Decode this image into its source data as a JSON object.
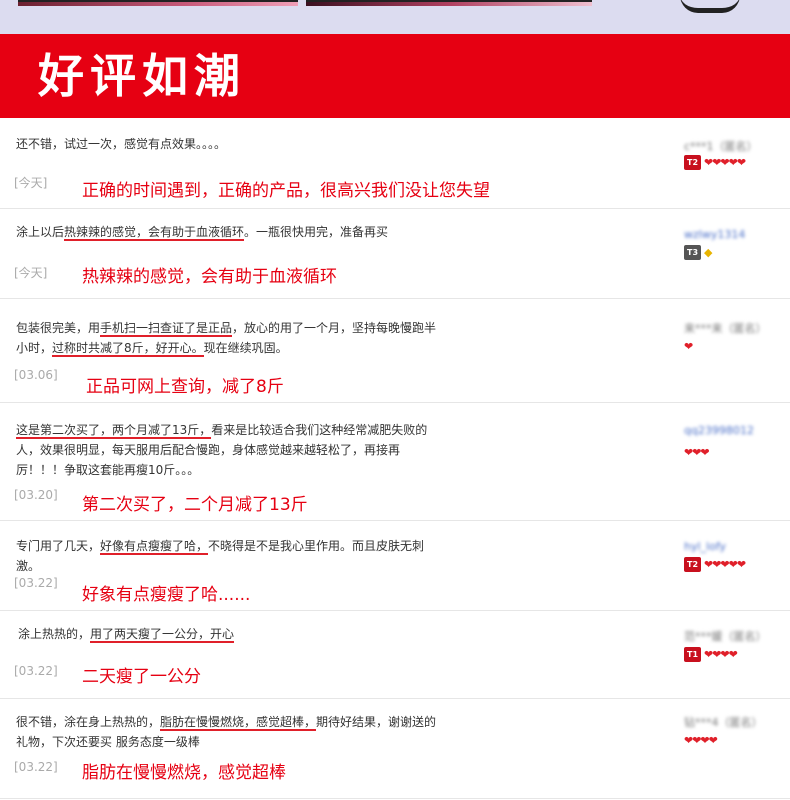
{
  "banner": {
    "title": "好评如潮"
  },
  "reviews": [
    {
      "before": "还不错，试过一次，感觉有点效果。。。。",
      "highlight": "",
      "between": "",
      "highlight2": "",
      "after": "",
      "date": "[今天]",
      "summary": "正确的时间遇到，正确的产品，很高兴我们没让您失望",
      "reviewer": "c***1（匿名）",
      "tier": "T2",
      "hearts": "❤❤❤❤❤"
    },
    {
      "before": "涂上以后",
      "highlight": "热辣辣的感觉，会有助于血液循环",
      "between": "。一瓶很快用完，准备再买",
      "highlight2": "",
      "after": "",
      "date": "[今天]",
      "summary": "热辣辣的感觉，会有助于血液循环",
      "reviewer": "wzlwy1314",
      "tier": "T3",
      "hearts": "◆"
    },
    {
      "before": "包装很完美，用",
      "highlight": "手机扫一扫查证了是正品",
      "between": "，放心的用了一个月，坚持每晚慢跑半小时，",
      "highlight2": "过称时共减了8斤，好开心。",
      "after": "现在继续巩固。",
      "date": "[03.06]",
      "summary": "正品可网上查询，减了8斤",
      "reviewer": "来***来（匿名）",
      "tier": "",
      "hearts": "❤"
    },
    {
      "before": "",
      "highlight": "这是第二次买了，两个月减了13斤，",
      "between": "看来是比较适合我们这种经常减肥失败的人，效果很明显，每天服用后配合慢跑，身体感觉越来越轻松了，再接再厉！！！争取这套能再瘦10斤。。。",
      "highlight2": "",
      "after": "",
      "date": "[03.20]",
      "summary": "第二次买了，二个月减了13斤",
      "reviewer": "qq23998012",
      "tier": "",
      "hearts": "❤❤❤"
    },
    {
      "before": "专门用了几天，",
      "highlight": "好像有点瘦瘦了哈，",
      "between": "不晓得是不是我心里作用。而且皮肤无刺激。",
      "highlight2": "",
      "after": "",
      "date": "[03.22]",
      "summary": "好象有点瘦瘦了哈......",
      "reviewer": "hyl_lofy",
      "tier": "T2",
      "hearts": "❤❤❤❤❤"
    },
    {
      "before": "涂上热热的，",
      "highlight": "用了两天瘦了一公分，开心",
      "between": "",
      "highlight2": "",
      "after": "",
      "date": "[03.22]",
      "summary": "二天瘦了一公分",
      "reviewer": "范***媛（匿名）",
      "tier": "T1",
      "hearts": "❤❤❤❤"
    },
    {
      "before": "很不错，涂在身上热热的，",
      "highlight": "脂肪在慢慢燃烧，感觉超棒，",
      "between": "期待好结果，谢谢送的礼物，下次还要买 服务态度一级棒",
      "highlight2": "",
      "after": "",
      "date": "[03.22]",
      "summary": "脂肪在慢慢燃烧，感觉超棒",
      "reviewer": "钻***4（匿名）",
      "tier": "",
      "hearts": "❤❤❤❤"
    }
  ]
}
